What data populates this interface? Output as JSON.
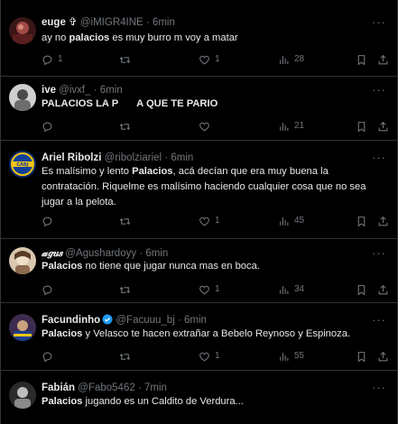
{
  "tweets": [
    {
      "name": "euge ✞",
      "handle": "@iMIGR4INE",
      "time": "6min",
      "text_before": "ay no ",
      "text_bold": "palacios",
      "text_after": " es muy burro m voy a matar",
      "replies": "1",
      "retweets": "",
      "likes": "1",
      "views": "28"
    },
    {
      "name": "ive",
      "handle": "@ivxf_",
      "time": "6min",
      "text_bold": "PALACIOS",
      "text_middle": " LA P",
      "text_after": "A QUE TE PARIO",
      "replies": "",
      "retweets": "",
      "likes": "",
      "views": "21"
    },
    {
      "name": "Ariel Ribolzi",
      "handle": "@ribolziariel",
      "time": "6min",
      "text_before": "Es malísimo y lento ",
      "text_bold": "Palacios",
      "text_after": ", acá decían que era muy buena la contratación. Riquelme es malísimo haciendo cualquier cosa que no sea jugar a la pelota.",
      "replies": "",
      "retweets": "",
      "likes": "1",
      "views": "45"
    },
    {
      "name": "𝓪𝒈𝒖𝒔",
      "handle": "@Agushardoyy",
      "time": "6min",
      "text_bold": "Palacios",
      "text_after": " no tiene que jugar nunca mas en boca.",
      "replies": "",
      "retweets": "",
      "likes": "1",
      "views": "34"
    },
    {
      "name": "Facundinho",
      "handle": "@Facuuu_bj",
      "time": "6min",
      "text_bold": "Palacios",
      "text_after": " y Velasco te hacen extrañar a Bebelo Reynoso y Espinoza.",
      "replies": "",
      "retweets": "",
      "likes": "1",
      "views": "55"
    },
    {
      "name": "Fabián",
      "handle": "@Fabo5462",
      "time": "7min",
      "text_bold": "Palacios",
      "text_after": " jugando es un Caldito de Verdura...",
      "replies": "",
      "retweets": "",
      "likes": "",
      "views": ""
    }
  ],
  "separator": "·",
  "more_label": "···",
  "colors": {
    "background": "#000000",
    "text": "#e7e9ea",
    "muted": "#71767b",
    "border": "#2f3336",
    "verified": "#1d9bf0"
  },
  "icons": [
    "reply-icon",
    "retweet-icon",
    "like-icon",
    "views-icon",
    "bookmark-icon",
    "share-icon",
    "verified-icon"
  ]
}
